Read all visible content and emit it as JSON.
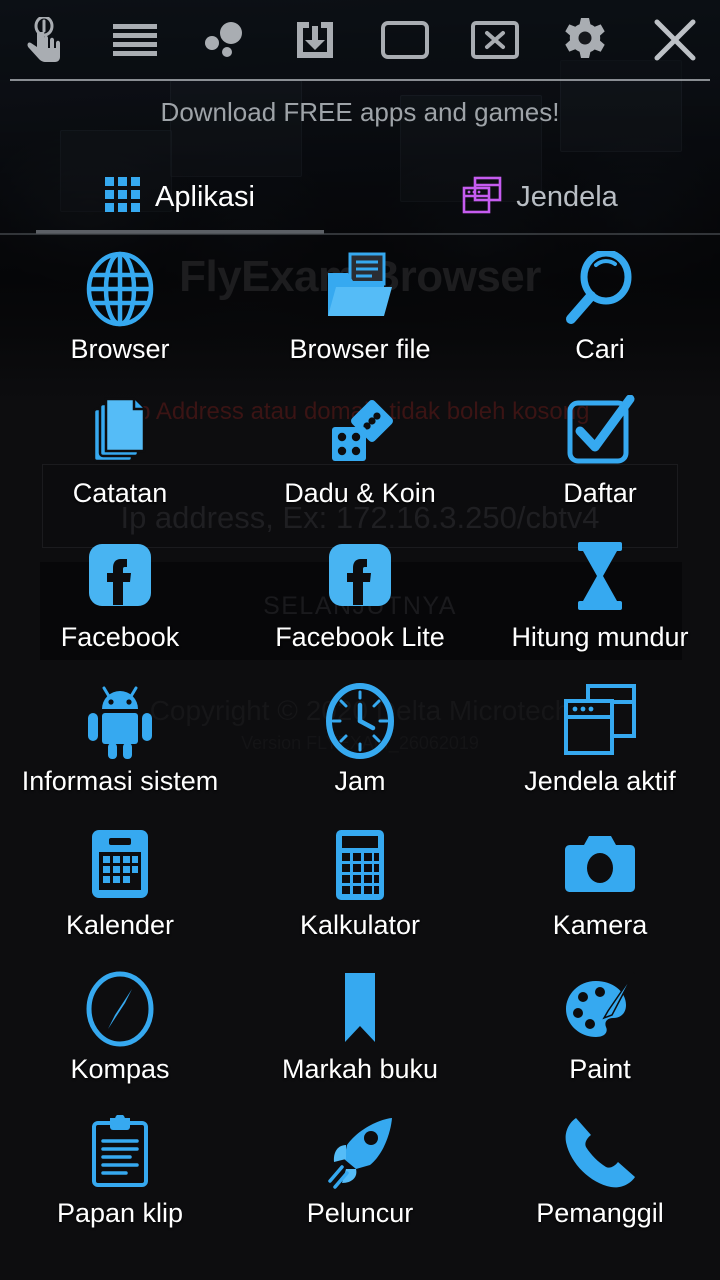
{
  "toolbar": {
    "buttons": [
      {
        "icon": "tap-hand-icon",
        "name": "tap-mode-button"
      },
      {
        "icon": "hamburger-menu-icon",
        "name": "menu-button"
      },
      {
        "icon": "bubbles-icon",
        "name": "bubbles-button"
      },
      {
        "icon": "download-icon",
        "name": "download-button"
      },
      {
        "icon": "window-icon",
        "name": "window-button"
      },
      {
        "icon": "close-window-icon",
        "name": "close-window-button"
      },
      {
        "icon": "gear-icon",
        "name": "settings-button"
      },
      {
        "icon": "x-icon",
        "name": "exit-button"
      }
    ]
  },
  "banner": {
    "text": "Download FREE apps and games!"
  },
  "tabs": [
    {
      "label": "Aplikasi",
      "icon": "grid-apps-icon",
      "active": true
    },
    {
      "label": "Jendela",
      "icon": "windows-stack-icon",
      "active": false
    }
  ],
  "apps": [
    {
      "label": "Browser",
      "icon": "globe-icon"
    },
    {
      "label": "Browser file",
      "icon": "file-folder-icon"
    },
    {
      "label": "Cari",
      "icon": "magnifier-icon"
    },
    {
      "label": "Catatan",
      "icon": "notes-pages-icon"
    },
    {
      "label": "Dadu & Koin",
      "icon": "dice-icon"
    },
    {
      "label": "Daftar",
      "icon": "checkbox-list-icon"
    },
    {
      "label": "Facebook",
      "icon": "facebook-icon"
    },
    {
      "label": "Facebook Lite",
      "icon": "facebook-lite-icon"
    },
    {
      "label": "Hitung mundur",
      "icon": "hourglass-icon"
    },
    {
      "label": "Informasi sistem",
      "icon": "android-robot-icon"
    },
    {
      "label": "Jam",
      "icon": "clock-icon"
    },
    {
      "label": "Jendela aktif",
      "icon": "active-windows-icon"
    },
    {
      "label": "Kalender",
      "icon": "calendar-icon"
    },
    {
      "label": "Kalkulator",
      "icon": "calculator-icon"
    },
    {
      "label": "Kamera",
      "icon": "camera-icon"
    },
    {
      "label": "Kompas",
      "icon": "compass-icon"
    },
    {
      "label": "Markah buku",
      "icon": "bookmark-icon"
    },
    {
      "label": "Paint",
      "icon": "paint-palette-icon"
    },
    {
      "label": "Papan klip",
      "icon": "clipboard-icon"
    },
    {
      "label": "Peluncur",
      "icon": "rocket-icon"
    },
    {
      "label": "Pemanggil",
      "icon": "phone-icon"
    }
  ],
  "background_app": {
    "title": "FlyExam Browser",
    "error_message": "Ip Address atau domain tidak boleh kosong",
    "input_placeholder": "Ip address, Ex: 172.16.3.250/cbtv4",
    "next_button": "SELANJUTNYA",
    "copyright": "Copyright © 2020 Delta Microtech",
    "version": "Version FLYEXAM_26062019"
  },
  "colors": {
    "accent_blue": "#36a9f0",
    "toolbar_icon": "#a9adb2",
    "tab_purple": "#c65cf0",
    "text_white": "#ffffff",
    "background": "#111113"
  }
}
